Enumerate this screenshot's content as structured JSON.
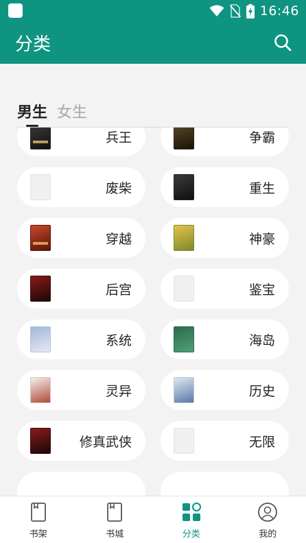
{
  "status_bar": {
    "time": "16:46",
    "icons": [
      "app-notification-icon",
      "wifi-icon",
      "no-sim-icon",
      "battery-charging-icon"
    ]
  },
  "app_bar": {
    "title": "分类",
    "search_icon": "search-icon"
  },
  "tabs": [
    {
      "label": "男生",
      "active": true
    },
    {
      "label": "女生",
      "active": false
    }
  ],
  "categories": [
    {
      "label": "兵王"
    },
    {
      "label": "争霸"
    },
    {
      "label": "废柴"
    },
    {
      "label": "重生"
    },
    {
      "label": "穿越"
    },
    {
      "label": "神豪"
    },
    {
      "label": "后宫"
    },
    {
      "label": "鉴宝"
    },
    {
      "label": "系统"
    },
    {
      "label": "海岛"
    },
    {
      "label": "灵异"
    },
    {
      "label": "历史"
    },
    {
      "label": "修真武侠"
    },
    {
      "label": "无限"
    }
  ],
  "bottom_nav": [
    {
      "label": "书架",
      "icon": "bookshelf-icon",
      "active": false
    },
    {
      "label": "书城",
      "icon": "bookstore-icon",
      "active": false
    },
    {
      "label": "分类",
      "icon": "category-grid-icon",
      "active": true
    },
    {
      "label": "我的",
      "icon": "profile-icon",
      "active": false
    }
  ],
  "colors": {
    "brand": "#0e9481",
    "background": "#f3f3f3",
    "card": "#ffffff",
    "text": "#222222",
    "inactive_tab": "#a8a8a8"
  }
}
